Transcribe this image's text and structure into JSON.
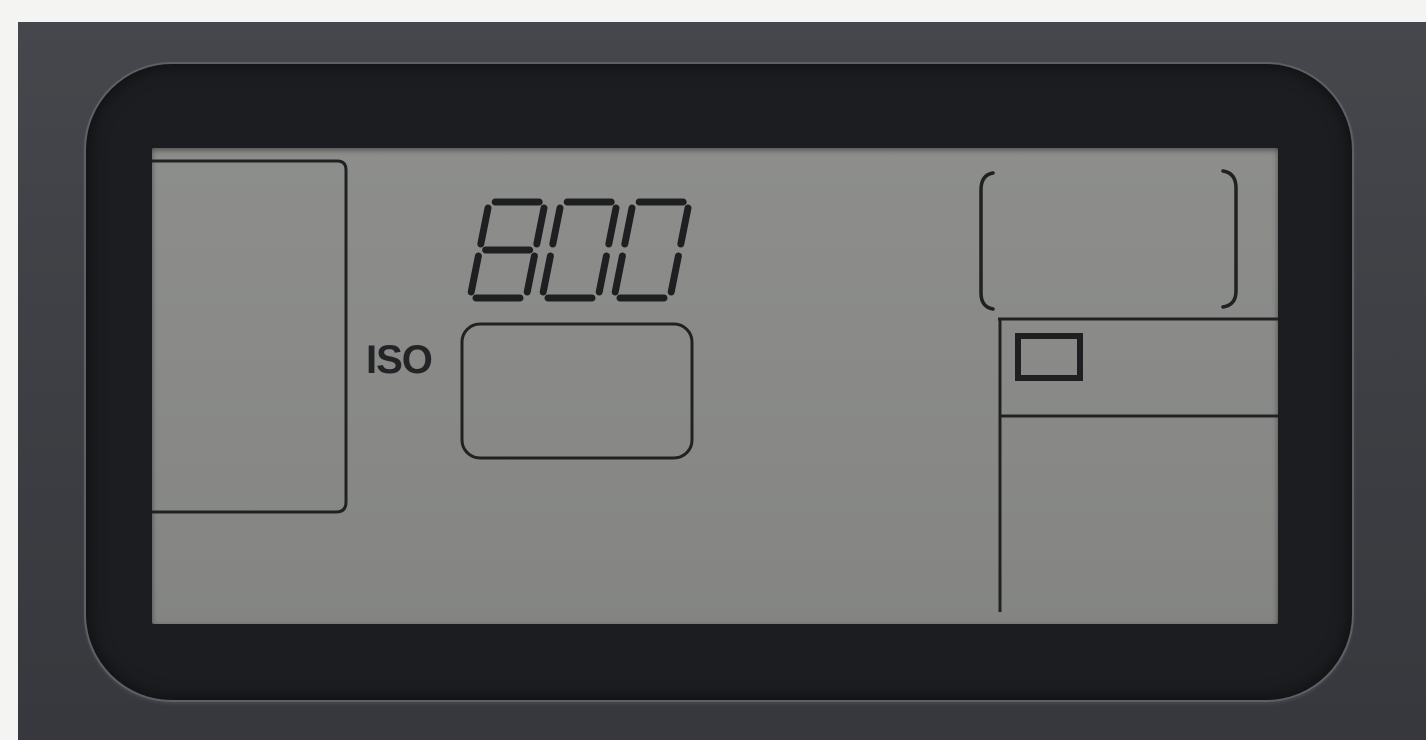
{
  "display": {
    "iso_value": "800",
    "iso_label": "ISO"
  },
  "colors": {
    "bezel": "#3f4146",
    "frame": "#1c1d20",
    "lcd_background": "#898a88",
    "lcd_segments": "#1e1f20"
  },
  "icons": {
    "frame_indicator": "rectangle-outline-icon"
  }
}
